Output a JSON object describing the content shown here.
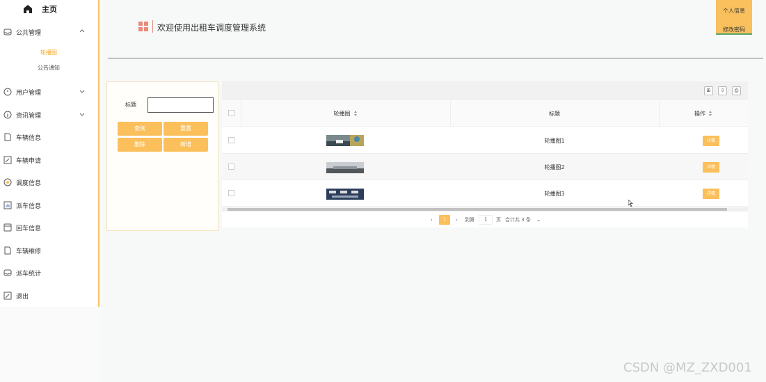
{
  "sidebar": {
    "home_label": "主页",
    "menu": [
      {
        "label": "公共管理",
        "icon": "inbox-icon",
        "chevron": "up"
      },
      {
        "label": "用户管理",
        "icon": "clock-icon",
        "chevron": "down"
      },
      {
        "label": "资讯管理",
        "icon": "info-icon",
        "chevron": "down"
      },
      {
        "label": "车辆信息",
        "icon": "document-icon",
        "chevron": ""
      },
      {
        "label": "车辆申请",
        "icon": "form-icon",
        "chevron": ""
      },
      {
        "label": "调度信息",
        "icon": "coin-icon",
        "chevron": ""
      },
      {
        "label": "派车信息",
        "icon": "chart-icon",
        "chevron": ""
      },
      {
        "label": "回车信息",
        "icon": "window-icon",
        "chevron": ""
      },
      {
        "label": "车辆维修",
        "icon": "document-icon",
        "chevron": ""
      },
      {
        "label": "派车统计",
        "icon": "inbox-icon",
        "chevron": ""
      },
      {
        "label": "退出",
        "icon": "form-icon",
        "chevron": ""
      }
    ],
    "submenu": [
      {
        "label": "轮播图",
        "active": true
      },
      {
        "label": "公告通知",
        "active": false
      }
    ]
  },
  "header": {
    "title": "欢迎使用出租车调度管理系统",
    "user_menu": [
      "个人信息",
      "修改密码"
    ]
  },
  "search": {
    "label": "标题",
    "value": "",
    "buttons": [
      "查询",
      "重置",
      "删除",
      "新增"
    ]
  },
  "table": {
    "columns": [
      "轮播图",
      "标题",
      "操作"
    ],
    "rows": [
      {
        "image": "轮播图1 thumbnail",
        "title": "轮播图1",
        "action": "详情"
      },
      {
        "image": "轮播图2 thumbnail",
        "title": "轮播图2",
        "action": "详情"
      },
      {
        "image": "轮播图3 thumbnail",
        "title": "轮播图3",
        "action": "详情"
      }
    ]
  },
  "pagination": {
    "current_page": "1",
    "goto_label": "到第",
    "goto_value": "1",
    "page_unit": "页",
    "total_text": "合计共 3 条"
  },
  "watermark": "CSDN @MZ_ZXD001",
  "colors": {
    "accent": "#fbbf5b",
    "sidebar_border": "#f7c26a",
    "active_submenu": "#f5a623",
    "header_icon": "#e98a7b"
  }
}
